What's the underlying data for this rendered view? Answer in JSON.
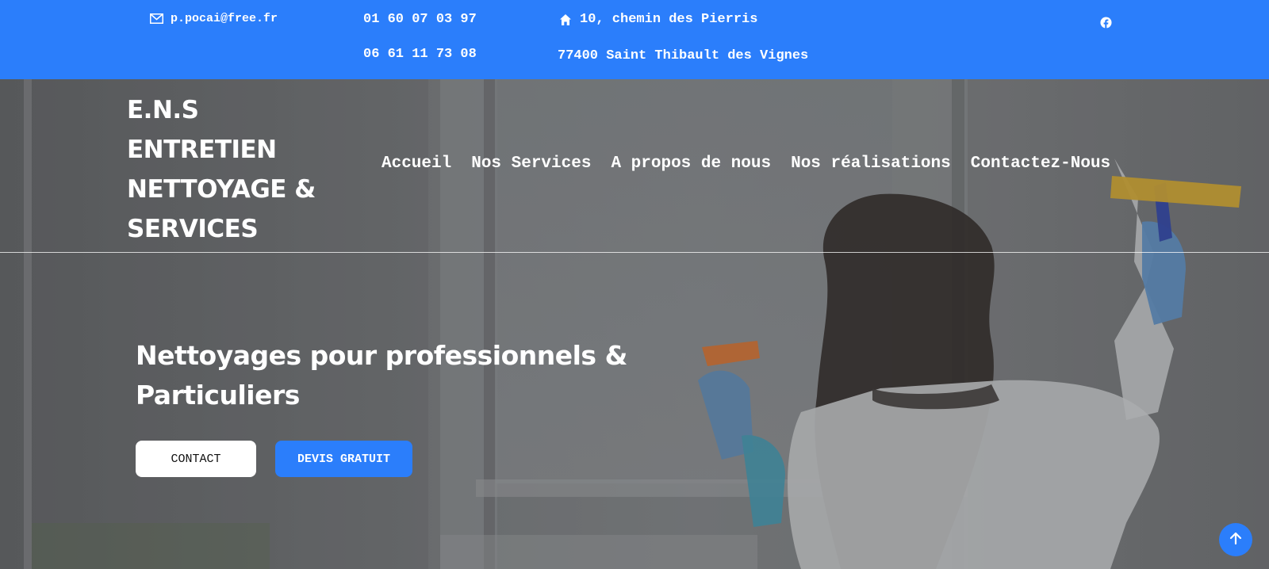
{
  "topbar": {
    "email": "p.pocai@free.fr",
    "phone_1": "01 60 07 03 97",
    "phone_2": "06 61 11 73 08",
    "address_line_1": "10, chemin des Pierris",
    "address_line_2": "77400 Saint Thibault des Vignes",
    "icons": {
      "email": "envelope-icon",
      "address": "home-icon",
      "social": "facebook-icon"
    }
  },
  "brand": {
    "lines": [
      "E.N.S",
      "ENTRETIEN",
      "NETTOYAGE &",
      "SERVICES"
    ]
  },
  "nav": {
    "items": [
      "Accueil",
      "Nos Services",
      "A propos de nous",
      "Nos réalisations",
      "Contactez-Nous"
    ]
  },
  "hero": {
    "headline_line_1": "Nettoyages pour professionnels &",
    "headline_line_2": "Particuliers",
    "contact_label": "CONTACT",
    "devis_label": "DEVIS GRATUIT"
  },
  "scroll_top": {
    "icon": "arrow-up-icon"
  },
  "colors": {
    "accent": "#2b7efb",
    "text_light": "#ffffff",
    "button_light": "#ffffff"
  }
}
